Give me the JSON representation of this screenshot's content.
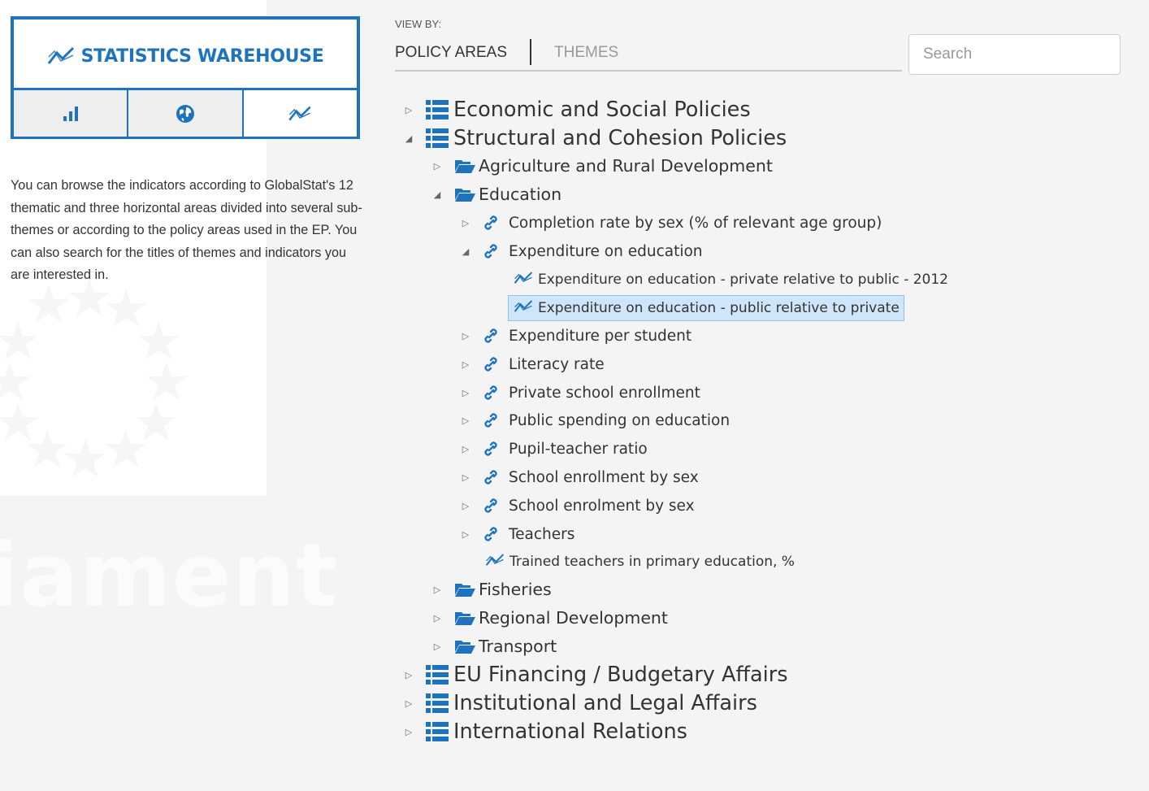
{
  "brand": {
    "title": "STATISTICS WAREHOUSE",
    "accent_color": "#1e73be",
    "logo_icon": "trend-line-icon",
    "tabs": [
      {
        "icon": "bar-chart-icon",
        "active": false
      },
      {
        "icon": "globe-icon",
        "active": false
      },
      {
        "icon": "trend-line-icon",
        "active": true
      }
    ]
  },
  "intro": {
    "text": "You can browse the indicators according to GlobalStat's 12 thematic and three horizontal areas divided into several sub-themes or according to the policy areas used in the EP. You can also search for the titles of themes and indicators you are interested in."
  },
  "background": {
    "word": "iament"
  },
  "view_by": {
    "label": "VIEW BY:",
    "tabs": [
      {
        "label": "POLICY AREAS",
        "active": true
      },
      {
        "label": "THEMES",
        "active": false
      }
    ]
  },
  "search": {
    "placeholder": "Search",
    "value": ""
  },
  "tree": {
    "highlight_color": "#cfe6fa",
    "nodes": [
      {
        "label": "Economic and Social Policies",
        "level": 0,
        "state": "collapsed",
        "icon": "list-icon"
      },
      {
        "label": "Structural and Cohesion Policies",
        "level": 0,
        "state": "expanded",
        "icon": "list-icon"
      },
      {
        "label": "Agriculture and Rural Development",
        "level": 1,
        "state": "collapsed",
        "icon": "folder-open-icon"
      },
      {
        "label": "Education",
        "level": 1,
        "state": "expanded",
        "icon": "folder-open-icon"
      },
      {
        "label": "Completion rate by sex (% of relevant age group)",
        "level": 2,
        "state": "collapsed",
        "icon": "link-icon"
      },
      {
        "label": "Expenditure on education",
        "level": 2,
        "state": "expanded",
        "icon": "link-icon"
      },
      {
        "label": "Expenditure on education - private relative to public - 2012",
        "level": 3,
        "state": "leaf",
        "icon": "trend-line-icon"
      },
      {
        "label": "Expenditure on education - public relative to private",
        "level": 3,
        "state": "leaf",
        "icon": "trend-line-icon",
        "selected": true
      },
      {
        "label": "Expenditure per student",
        "level": 2,
        "state": "collapsed",
        "icon": "link-icon"
      },
      {
        "label": "Literacy rate",
        "level": 2,
        "state": "collapsed",
        "icon": "link-icon"
      },
      {
        "label": "Private school enrollment",
        "level": 2,
        "state": "collapsed",
        "icon": "link-icon"
      },
      {
        "label": "Public spending on education",
        "level": 2,
        "state": "collapsed",
        "icon": "link-icon"
      },
      {
        "label": "Pupil-teacher ratio",
        "level": 2,
        "state": "collapsed",
        "icon": "link-icon"
      },
      {
        "label": "School enrollment by sex",
        "level": 2,
        "state": "collapsed",
        "icon": "link-icon"
      },
      {
        "label": "School enrolment by sex",
        "level": 2,
        "state": "collapsed",
        "icon": "link-icon"
      },
      {
        "label": "Teachers",
        "level": 2,
        "state": "collapsed",
        "icon": "link-icon"
      },
      {
        "label": "Trained teachers in primary education, %",
        "level": 2,
        "state": "leaf",
        "icon": "trend-line-icon"
      },
      {
        "label": "Fisheries",
        "level": 1,
        "state": "collapsed",
        "icon": "folder-open-icon"
      },
      {
        "label": "Regional Development",
        "level": 1,
        "state": "collapsed",
        "icon": "folder-open-icon"
      },
      {
        "label": "Transport",
        "level": 1,
        "state": "collapsed",
        "icon": "folder-open-icon"
      },
      {
        "label": "EU Financing / Budgetary Affairs",
        "level": 0,
        "state": "collapsed",
        "icon": "list-icon"
      },
      {
        "label": "Institutional and Legal Affairs",
        "level": 0,
        "state": "collapsed",
        "icon": "list-icon"
      },
      {
        "label": "International Relations",
        "level": 0,
        "state": "collapsed",
        "icon": "list-icon"
      }
    ]
  }
}
